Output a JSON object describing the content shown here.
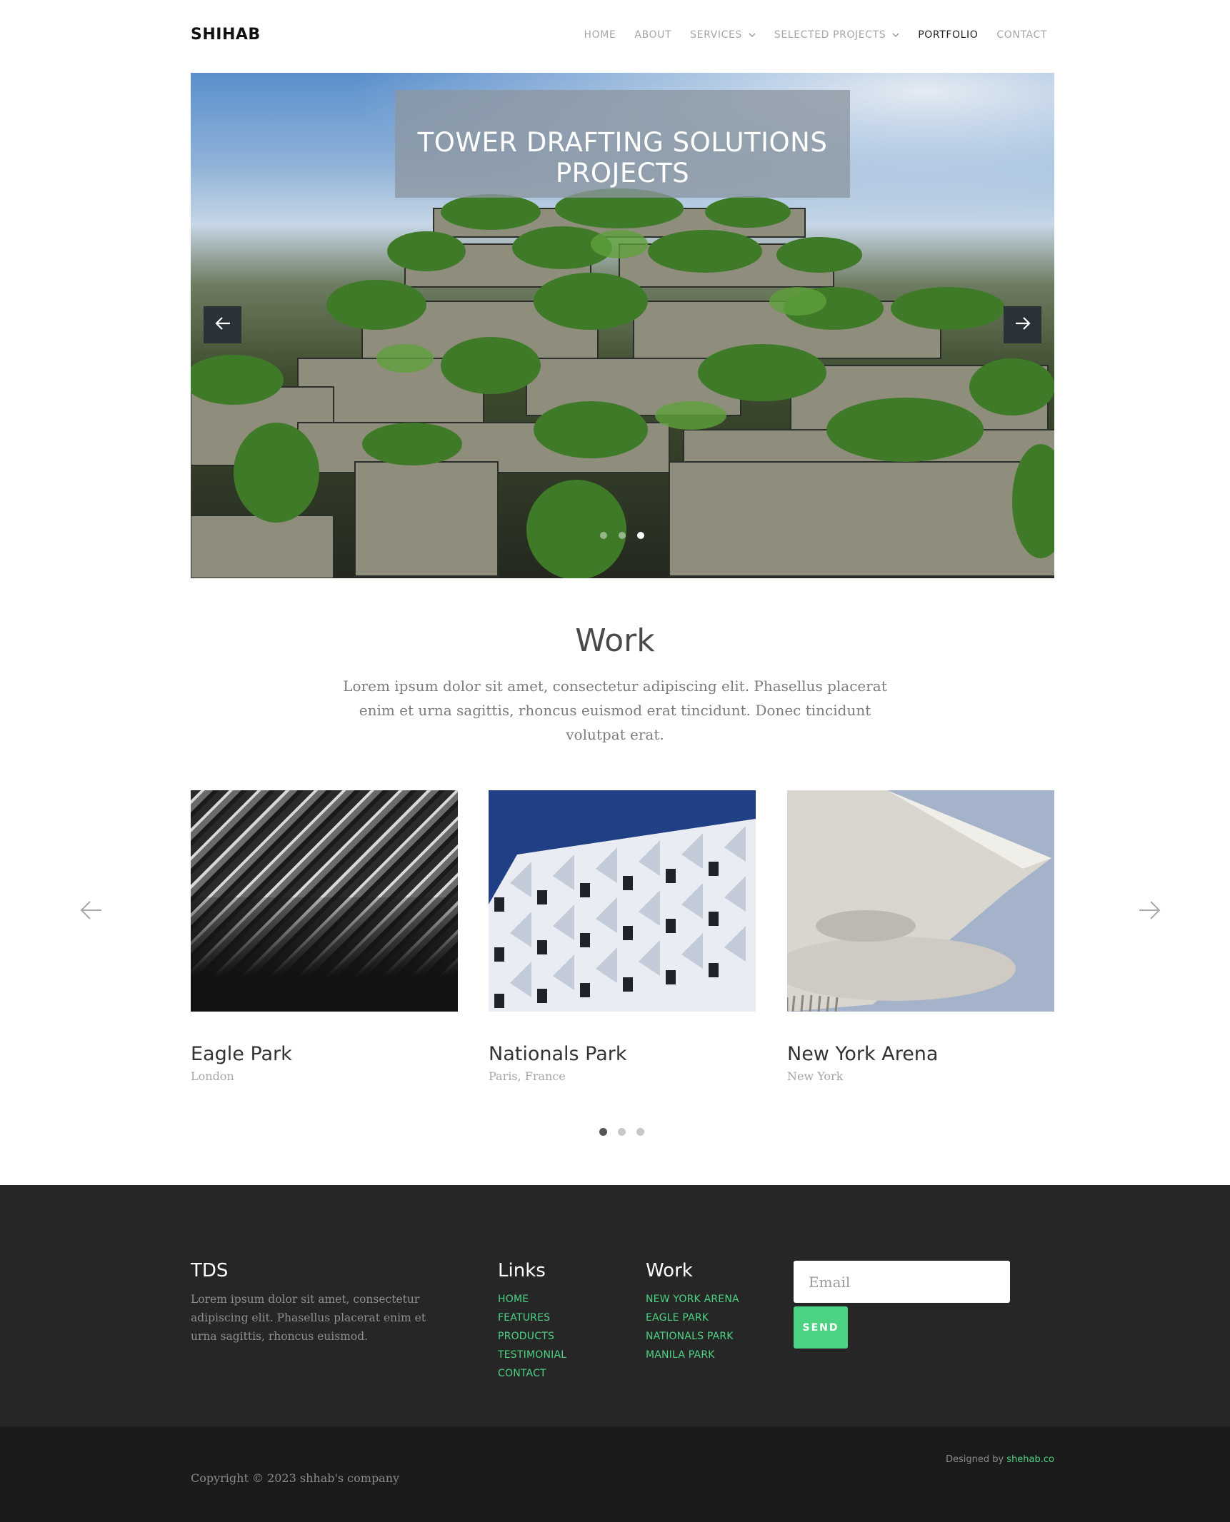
{
  "header": {
    "brand": "SHIHAB",
    "nav": [
      {
        "label": "HOME",
        "dropdown": false,
        "active": false
      },
      {
        "label": "ABOUT",
        "dropdown": false,
        "active": false
      },
      {
        "label": "SERVICES",
        "dropdown": true,
        "active": false
      },
      {
        "label": "SELECTED PROJECTS",
        "dropdown": true,
        "active": false
      },
      {
        "label": "PORTFOLIO",
        "dropdown": false,
        "active": true
      },
      {
        "label": "CONTACT",
        "dropdown": false,
        "active": false
      }
    ]
  },
  "hero": {
    "title_line1": "TOWER DRAFTING SOLUTIONS",
    "title_line2": "PROJECTS",
    "slide_count": 3,
    "active_slide": 2,
    "icons": {
      "prev": "arrow-left-icon",
      "next": "arrow-right-icon"
    }
  },
  "work": {
    "title": "Work",
    "intro": "Lorem ipsum dolor sit amet, consectetur adipiscing elit. Phasellus placerat enim et urna sagittis, rhoncus euismod erat tincidunt. Donec tincidunt volutpat erat.",
    "projects": [
      {
        "name": "Eagle Park",
        "place": "London"
      },
      {
        "name": "Nationals Park",
        "place": "Paris, France"
      },
      {
        "name": "New York Arena",
        "place": "New York"
      }
    ],
    "page_count": 3,
    "active_page": 0
  },
  "footer": {
    "about": {
      "title": "TDS",
      "text": "Lorem ipsum dolor sit amet, consectetur adipiscing elit. Phasellus placerat enim et urna sagittis, rhoncus euismod."
    },
    "links": {
      "title": "Links",
      "items": [
        "HOME",
        "FEATURES",
        "PRODUCTS",
        "TESTIMONIAL",
        "CONTACT"
      ]
    },
    "work": {
      "title": "Work",
      "items": [
        "NEW YORK ARENA",
        "EAGLE PARK",
        "NATIONALS PARK",
        "MANILA PARK"
      ]
    },
    "newsletter": {
      "placeholder": "Email",
      "value": "",
      "button": "SEND"
    },
    "copyright": "Copyright © 2023 shhab's company",
    "designed_by_prefix": "Designed by",
    "designed_by_link": "shehab.co"
  },
  "colors": {
    "accent": "#4bd383",
    "footer_bg": "#262626",
    "bottombar_bg": "#1b1b1b"
  }
}
